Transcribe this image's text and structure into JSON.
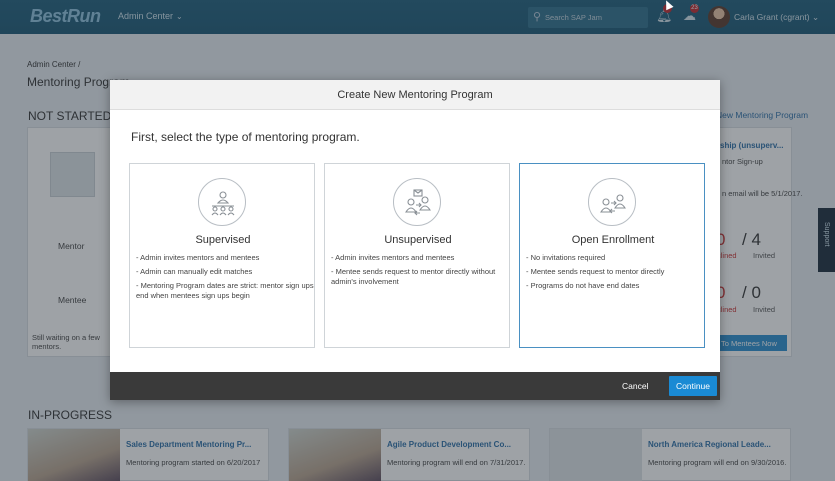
{
  "header": {
    "logo": "BestRun",
    "admin_menu": "Admin Center",
    "search_placeholder": "Search SAP Jam",
    "notif_count": "1",
    "messages_count": "23",
    "user_name": "Carla Grant (cgrant)"
  },
  "page": {
    "breadcrumb": "Admin Center  /",
    "title": "Mentoring Program",
    "not_started_label": "NOT STARTED",
    "new_program_link": "New Mentoring Program",
    "role_mentor": "Mentor",
    "role_mentee": "Mentee",
    "waiting_text": "Still waiting on a few mentors.",
    "right_card": {
      "title": "ship (unsuperv...",
      "subtitle": "ntor Sign-up",
      "text": "n email will be 5/1/2017.",
      "mentor_declined": "0",
      "mentor_invited": "4",
      "mentee_declined": "0",
      "mentee_invited": "0",
      "declined_label": "clined",
      "invited_label": "Invited",
      "button": "To Mentees Now"
    },
    "in_progress_label": "IN-PROGRESS",
    "cards": [
      {
        "title": "Sales Department Mentoring Pr...",
        "text": "Mentoring program started on 6/20/2017"
      },
      {
        "title": "Agile Product Development Co...",
        "text": "Mentoring program will end on 7/31/2017."
      },
      {
        "title": "North America Regional Leade...",
        "text": "Mentoring program will end on 9/30/2016."
      }
    ],
    "support_tab": "Support"
  },
  "dialog": {
    "title": "Create New Mentoring Program",
    "prompt": "First, select the type of mentoring program.",
    "options": [
      {
        "title": "Supervised",
        "icon": "mentor-group-icon",
        "bullets": [
          "- Admin invites mentors and mentees",
          "- Admin can manually edit matches",
          "- Mentoring Program dates are strict: mentor sign ups end when mentees sign ups begin"
        ]
      },
      {
        "title": "Unsupervised",
        "icon": "mentor-request-icon",
        "bullets": [
          "- Admin invites mentors and mentees",
          "- Mentee sends request to mentor directly without admin's involvement"
        ]
      },
      {
        "title": "Open Enrollment",
        "icon": "open-enrollment-icon",
        "selected": true,
        "bullets": [
          "- No invitations required",
          "- Mentee sends request to mentor directly",
          "- Programs do not have end dates"
        ]
      }
    ],
    "cancel_label": "Cancel",
    "continue_label": "Continue"
  },
  "colors": {
    "header_bg": "#1f5f7c",
    "link_blue": "#2d6fa8",
    "primary_button": "#1a8ad4",
    "footer_bg": "#3a3a3a",
    "selected_border": "#4a90c2"
  }
}
